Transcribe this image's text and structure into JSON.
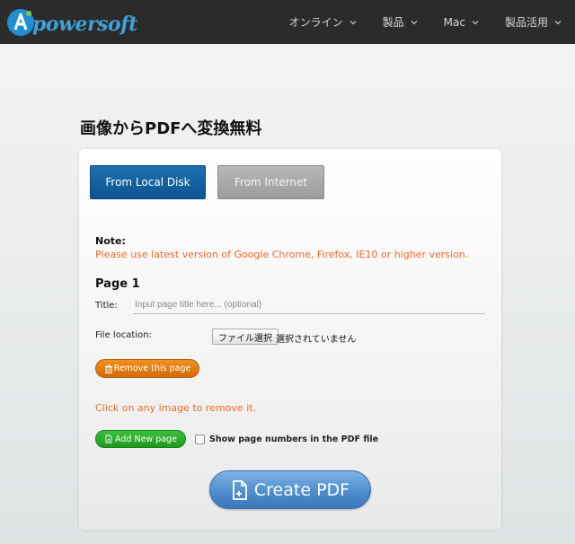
{
  "header": {
    "logo_text": "powersoft",
    "nav": [
      {
        "label": "オンライン"
      },
      {
        "label": "製品"
      },
      {
        "label": "Mac"
      },
      {
        "label": "製品活用"
      }
    ]
  },
  "page": {
    "title": "画像からPDFへ変換無料"
  },
  "tabs": {
    "local": "From Local Disk",
    "internet": "From Internet"
  },
  "note": {
    "label": "Note:",
    "text": "Please use latest version of Google Chrome, Firefox, IE10 or higher version."
  },
  "page_block": {
    "heading": "Page 1",
    "title_label": "Title:",
    "title_placeholder": "Input page title here... (optional)",
    "file_label": "File location:",
    "file_button": "ファイル選択",
    "file_status": "選択されていません",
    "remove_button": "Remove this page"
  },
  "hint": "Click on any image to remove it.",
  "actions": {
    "add_page": "Add New page",
    "show_numbers": "Show page numbers in the PDF file",
    "create": "Create PDF"
  },
  "colors": {
    "accent_blue": "#0b5592",
    "warning_orange": "#f26a2a",
    "remove_orange": "#e07a12",
    "add_green": "#2aa82a"
  }
}
